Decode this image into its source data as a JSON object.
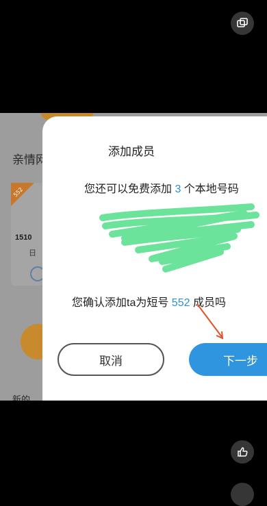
{
  "background": {
    "section_title": "亲情网",
    "badge_text": "552",
    "number_fragment": "1510",
    "sub_fragment": "日",
    "footer_fragment": "新的"
  },
  "dialog": {
    "title": "添加成员",
    "line1_prefix": "您还可以免费添加 ",
    "line1_count": "3",
    "line1_suffix": " 个本地号码",
    "line2_prefix": "您确认添加ta为短号 ",
    "line2_short_number": "552",
    "line2_suffix": " 成员吗",
    "cancel_label": "取消",
    "next_label": "下一步"
  },
  "colors": {
    "accent_blue": "#2e95de",
    "scribble_green": "#6be39a",
    "arrow_red": "#e0532a",
    "badge_orange": "#c8782b"
  },
  "icons": {
    "top_right": "pip-window-icon",
    "bottom_right": "thumbs-up-icon"
  }
}
